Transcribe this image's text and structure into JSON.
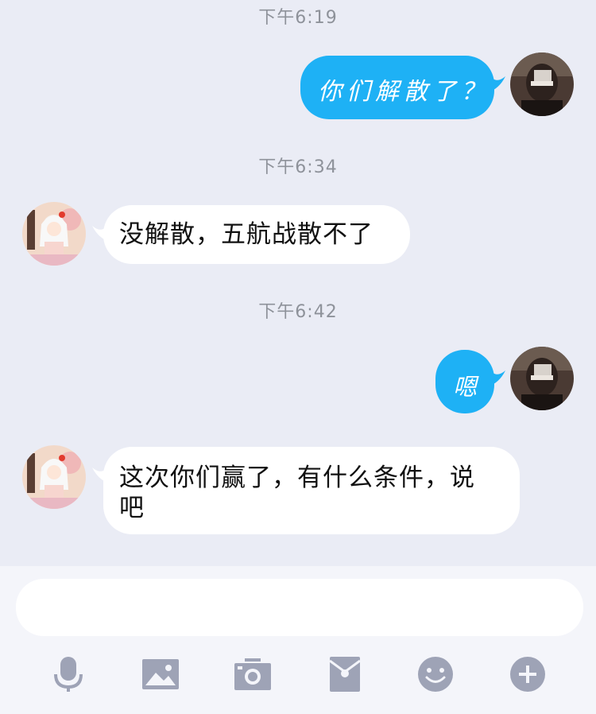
{
  "messages": [
    {
      "time": "下午6:19",
      "side": "out",
      "text": "你们解散了？"
    },
    {
      "time": "下午6:34",
      "side": "in",
      "text": "没解散，五航战散不了"
    },
    {
      "time": "下午6:42",
      "side": "out",
      "text": "嗯"
    },
    {
      "time": "",
      "side": "in",
      "text_line1": "这次你们赢了，有什么条件，说",
      "text_line2": "吧"
    }
  ],
  "composer": {
    "placeholder": "",
    "tools": [
      "microphone-icon",
      "image-icon",
      "camera-icon",
      "red-packet-icon",
      "emoji-icon",
      "plus-icon"
    ]
  },
  "colors": {
    "background": "#eaecf5",
    "outgoing_bubble": "#1eb1f5",
    "incoming_bubble": "#ffffff",
    "icon": "#9ea3b6"
  }
}
